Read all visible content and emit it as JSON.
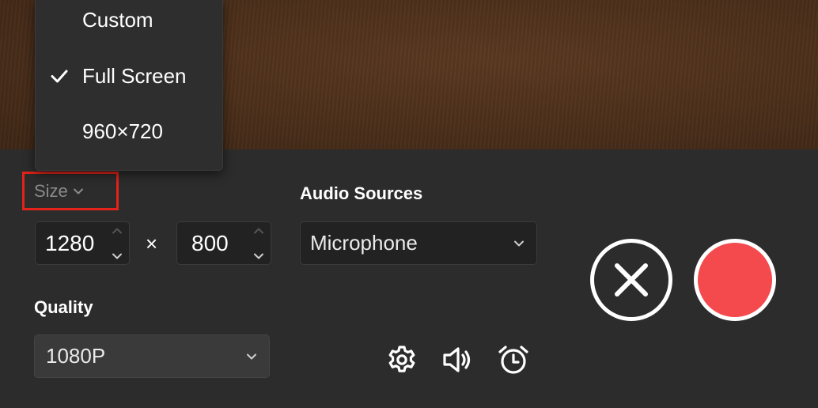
{
  "size_menu": {
    "items": [
      {
        "label": "Custom",
        "selected": false
      },
      {
        "label": "Full Screen",
        "selected": true
      },
      {
        "label": "960×720",
        "selected": false
      }
    ]
  },
  "size": {
    "label": "Size",
    "width": "1280",
    "height": "800",
    "separator": "×"
  },
  "audio": {
    "label": "Audio Sources",
    "selected": "Microphone"
  },
  "quality": {
    "label": "Quality",
    "selected": "1080P"
  },
  "toolbar": {
    "icons": [
      "gear-icon",
      "speaker-icon",
      "alarm-clock-icon"
    ]
  },
  "colors": {
    "record": "#f44a4d",
    "highlight": "#e2231a",
    "panel": "#2c2c2c"
  }
}
